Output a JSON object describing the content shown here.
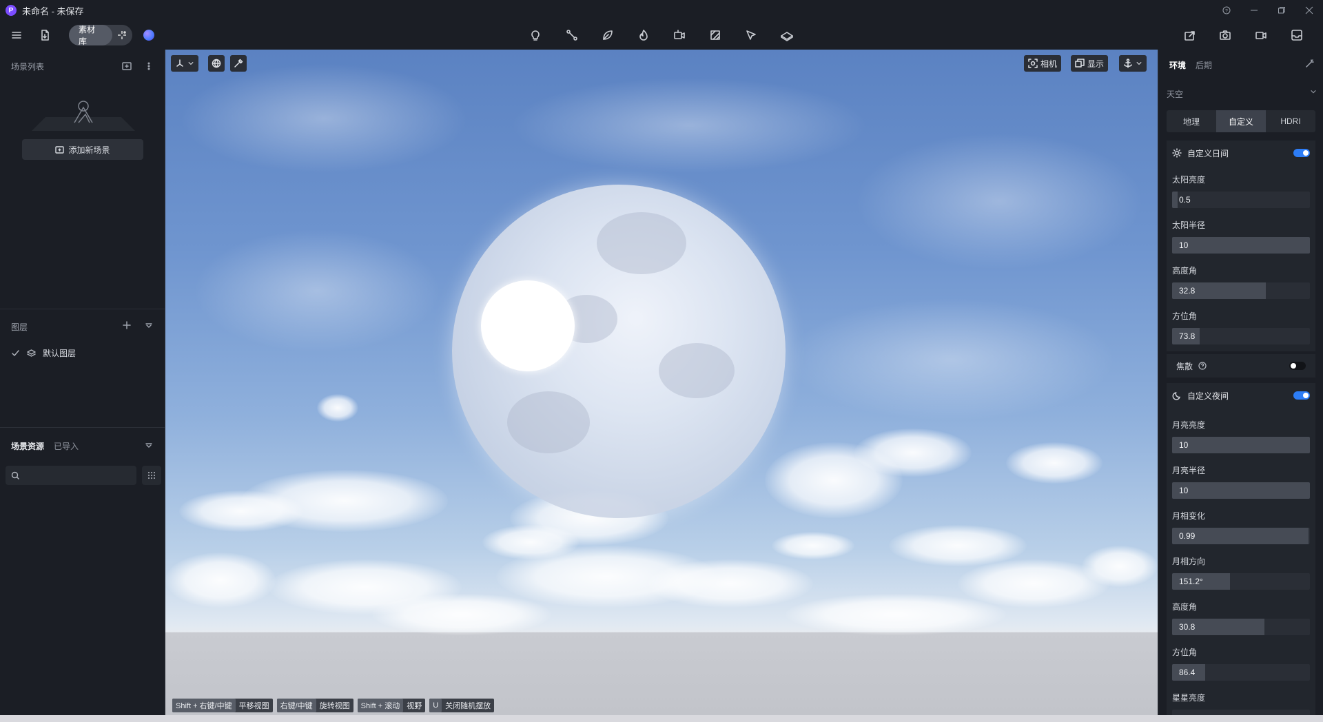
{
  "window": {
    "logo": "P",
    "title": "未命名 - 未保存"
  },
  "toolbar": {
    "library_label": "素材库"
  },
  "left": {
    "scene_list_title": "场景列表",
    "add_scene_label": "添加新场景",
    "layers_title": "图层",
    "default_layer": "默认图层",
    "assets_tab_active": "场景资源",
    "assets_tab_imported": "已导入",
    "search_placeholder": ""
  },
  "viewport": {
    "camera_label": "相机",
    "display_label": "显示",
    "hints": [
      {
        "key": "Shift + 右键/中键",
        "action": "平移视图"
      },
      {
        "key": "右键/中键",
        "action": "旋转视图"
      },
      {
        "key": "Shift + 滚动",
        "action": "视野"
      },
      {
        "key": "U",
        "action": "关闭随机摆放"
      }
    ]
  },
  "right": {
    "tab_env": "环境",
    "tab_post": "后期",
    "sky_title": "天空",
    "sky_modes": [
      "地理",
      "自定义",
      "HDRI"
    ],
    "sky_mode_active": 1,
    "day_title": "自定义日间",
    "day_enabled": true,
    "sun_brightness_label": "太阳亮度",
    "sun_brightness": "0.5",
    "sun_brightness_fill": 0.04,
    "sun_radius_label": "太阳半径",
    "sun_radius": "10",
    "sun_radius_fill": 1.0,
    "sun_elevation_label": "高度角",
    "sun_elevation": "32.8",
    "sun_elevation_fill": 0.68,
    "sun_azimuth_label": "方位角",
    "sun_azimuth": "73.8",
    "sun_azimuth_fill": 0.2,
    "caustics_label": "焦散",
    "caustics_enabled": false,
    "night_title": "自定义夜间",
    "night_enabled": true,
    "moon_brightness_label": "月亮亮度",
    "moon_brightness": "10",
    "moon_brightness_fill": 1.0,
    "moon_radius_label": "月亮半径",
    "moon_radius": "10",
    "moon_radius_fill": 1.0,
    "moon_phase_label": "月相变化",
    "moon_phase": "0.99",
    "moon_phase_fill": 0.99,
    "moon_phase_dir_label": "月相方向",
    "moon_phase_dir": "151.2°",
    "moon_phase_dir_fill": 0.42,
    "moon_elevation_label": "高度角",
    "moon_elevation": "30.8",
    "moon_elevation_fill": 0.67,
    "moon_azimuth_label": "方位角",
    "moon_azimuth": "86.4",
    "moon_azimuth_fill": 0.24,
    "star_brightness_label": "星星亮度"
  },
  "colors": {
    "accent": "#2d7df6",
    "panel_bg": "#1b1e25"
  }
}
